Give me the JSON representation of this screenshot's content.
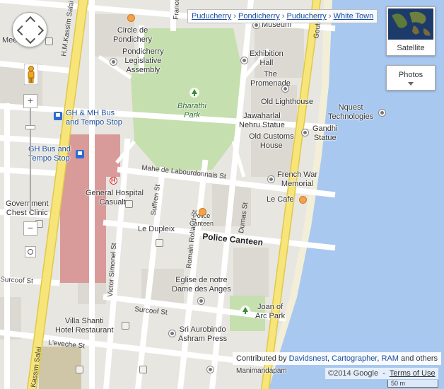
{
  "breadcrumb": [
    "Puducherry",
    "Pondicherry",
    "Puducherry",
    "White Town"
  ],
  "map_type": {
    "satellite_label": "Satellite"
  },
  "photos": {
    "label": "Photos"
  },
  "zoom": {
    "in_label": "+",
    "out_label": "−"
  },
  "contributors": {
    "prefix": "Contributed by",
    "names": [
      "Davidsnest",
      "Cartographer",
      "RAM"
    ],
    "suffix": "and others"
  },
  "footer": {
    "copyright": "©2014 Google",
    "terms": "Terms of Use"
  },
  "scale": {
    "label": "50 m"
  },
  "places": {
    "circle_de_pondichery": "Circle de\nPondichery",
    "legislative_assembly": "Pondicherry\nLegislative\nAssembly",
    "museum": "Museum",
    "exhibition_hall": "Exhibition\nHall",
    "the_promenade": "The\nPromenade",
    "old_lighthouse": "Old Lighthouse",
    "nquest": "Nquest\nTechnologies",
    "jawaharlal": "Jawaharlal\nNehru Statue",
    "gandhi": "Gandhi\nStatue",
    "old_customs": "Old Customs\nHouse",
    "bharathi_park": "Bharathi\nPark",
    "french_war": "French War\nMemorial",
    "le_cafe": "Le Cafe",
    "general_hospital": "General Hospital\nCasualty",
    "govt_chest": "Government\nChest Clinic",
    "police_canteen_small": "Police\nCanteen",
    "police_canteen": "Police Canteen",
    "le_dupleix": "Le Dupleix",
    "eglise": "Eglise de notre\nDame des Anges",
    "joan_park": "Joan of\nArc Park",
    "villa_shanti": "Villa Shanti\nHotel Restaurant",
    "sri_aurobindo": "Sri Aurobindo\nAshram Press",
    "manimandapam": "Manimandapam",
    "gh_mh_bus": "GH & MH Bus\nand Tempo Stop",
    "gh_bus": "GH Bus and\nTempo Stop",
    "mee": "Mee"
  },
  "streets": {
    "mahe": "Mahe de Labourdonnais St",
    "suffren": "Suffren St",
    "romain": "Romain Rolland St",
    "dumas": "Dumas St",
    "victor": "Victor Simonel St",
    "surcoof": "Surcoof St",
    "surcoof_left": "Surcoof St",
    "leveche": "L'eveche St",
    "hm_kassim": "H.M.Kassim Salai",
    "kassim_salai": "Kassim Salai",
    "goubert": "Goubert",
    "france": "France"
  },
  "colors": {
    "sea": "#a8c8f0",
    "park": "#c5dfae",
    "road": "#ffffff",
    "main_road": "#f7e57a",
    "hospital": "#d99a9a",
    "block": "#dcd9d2"
  }
}
